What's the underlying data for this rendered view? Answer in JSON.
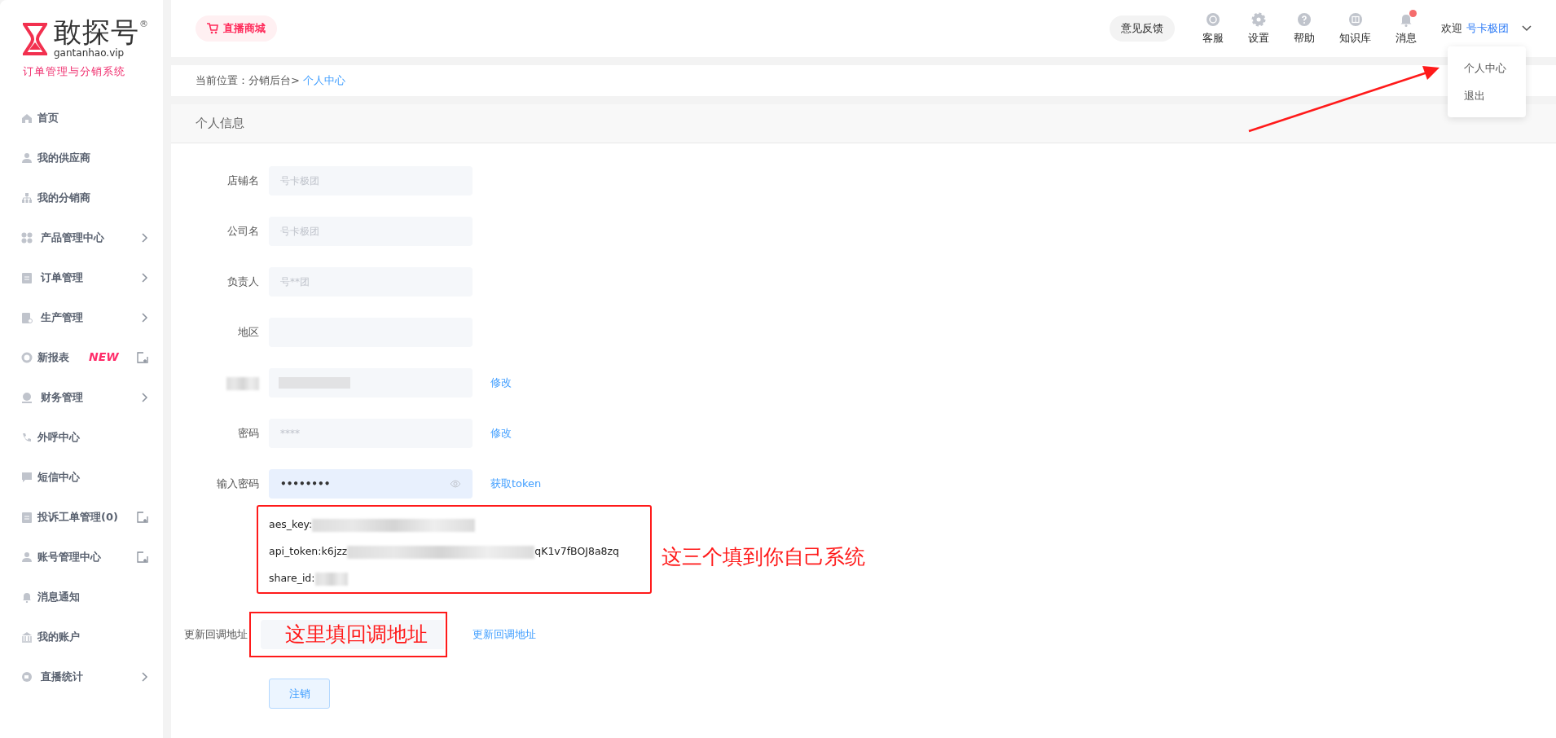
{
  "sidebar": {
    "logo": {
      "name": "敢探号",
      "registered": "®",
      "domain": "gantanhao.vip",
      "subtitle": "订单管理与分销系统"
    },
    "items": [
      {
        "label": "首页",
        "has_submenu": false,
        "external": false
      },
      {
        "label": "我的供应商",
        "has_submenu": false,
        "external": false
      },
      {
        "label": "我的分销商",
        "has_submenu": false,
        "external": false
      },
      {
        "label": "产品管理中心",
        "has_submenu": true,
        "external": false
      },
      {
        "label": "订单管理",
        "has_submenu": true,
        "external": false
      },
      {
        "label": "生产管理",
        "has_submenu": true,
        "external": false
      },
      {
        "label": "新报表",
        "badge": "NEW",
        "has_submenu": false,
        "external": true
      },
      {
        "label": "财务管理",
        "has_submenu": true,
        "external": false
      },
      {
        "label": "外呼中心",
        "has_submenu": false,
        "external": false
      },
      {
        "label": "短信中心",
        "has_submenu": false,
        "external": false
      },
      {
        "label": "投诉工单管理(0)",
        "has_submenu": false,
        "external": true
      },
      {
        "label": "账号管理中心",
        "has_submenu": false,
        "external": true
      },
      {
        "label": "消息通知",
        "has_submenu": false,
        "external": false
      },
      {
        "label": "我的账户",
        "has_submenu": false,
        "external": false
      },
      {
        "label": "直播统计",
        "has_submenu": true,
        "external": false
      }
    ]
  },
  "topbar": {
    "mall_button": "直播商城",
    "feedback_button": "意见反馈",
    "tools": [
      {
        "label": "客服",
        "unread": false
      },
      {
        "label": "设置",
        "unread": false
      },
      {
        "label": "帮助",
        "unread": false
      },
      {
        "label": "知识库",
        "unread": false
      },
      {
        "label": "消息",
        "unread": true
      }
    ],
    "welcome": "欢迎",
    "user": "号卡极团",
    "user_menu": {
      "expanded": true,
      "items": [
        {
          "label": "个人中心"
        },
        {
          "label": "退出"
        }
      ]
    }
  },
  "breadcrumb": {
    "path": "当前位置：分销后台>",
    "current": "个人中心"
  },
  "panel": {
    "title": "个人信息",
    "fields": [
      {
        "label": "店铺名",
        "placeholder": "号卡极团"
      },
      {
        "label": "公司名",
        "placeholder": "号卡极团"
      },
      {
        "label": "负责人",
        "placeholder": "号**团"
      },
      {
        "label": "地区"
      },
      {
        "redacted": true,
        "action": "修改"
      },
      {
        "label": "密码",
        "placeholder": "****",
        "action": "修改"
      },
      {
        "label": "输入密码",
        "kind": "password",
        "value": "••••••••",
        "focused": true,
        "action": "获取token"
      }
    ],
    "tokens": [
      {
        "text": "aes_key:",
        "redacted": true
      },
      {
        "text": "api_token:k6jzz",
        "redacted": true,
        "suffix": "qK1v7fBOJ8a8zq"
      },
      {
        "text": "share_id:",
        "redacted": true
      }
    ],
    "callback": {
      "label": "更新回调地址",
      "action": "更新回调地址"
    },
    "logout_button": "注销"
  },
  "annotations": {
    "tokens_note": "这三个填到你自己系统",
    "callback_note": "这里填回调地址",
    "arrow": true
  }
}
